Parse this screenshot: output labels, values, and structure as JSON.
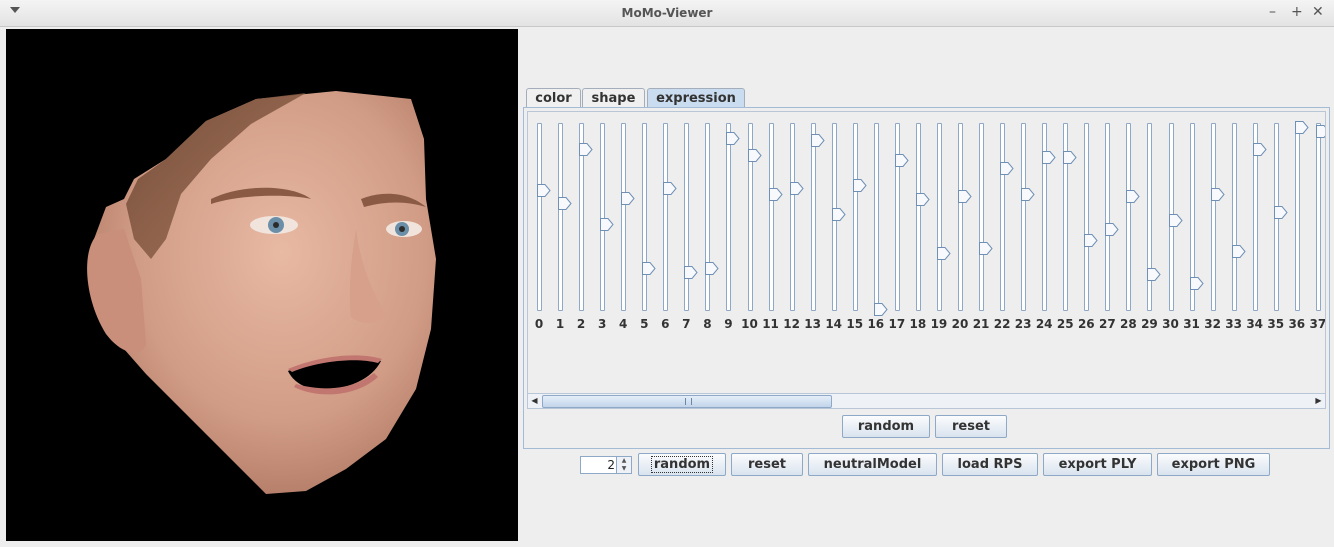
{
  "window": {
    "title": "MoMo-Viewer"
  },
  "tabs": [
    {
      "label": "color",
      "active": false
    },
    {
      "label": "shape",
      "active": false
    },
    {
      "label": "expression",
      "active": true
    }
  ],
  "sliders": [
    {
      "label": "0",
      "value": 0.65
    },
    {
      "label": "1",
      "value": 0.58
    },
    {
      "label": "2",
      "value": 0.87
    },
    {
      "label": "3",
      "value": 0.47
    },
    {
      "label": "4",
      "value": 0.61
    },
    {
      "label": "5",
      "value": 0.23
    },
    {
      "label": "6",
      "value": 0.66
    },
    {
      "label": "7",
      "value": 0.21
    },
    {
      "label": "8",
      "value": 0.23
    },
    {
      "label": "9",
      "value": 0.93
    },
    {
      "label": "10",
      "value": 0.84
    },
    {
      "label": "11",
      "value": 0.63
    },
    {
      "label": "12",
      "value": 0.66
    },
    {
      "label": "13",
      "value": 0.92
    },
    {
      "label": "14",
      "value": 0.52
    },
    {
      "label": "15",
      "value": 0.68
    },
    {
      "label": "16",
      "value": 0.01
    },
    {
      "label": "17",
      "value": 0.81
    },
    {
      "label": "18",
      "value": 0.6
    },
    {
      "label": "19",
      "value": 0.31
    },
    {
      "label": "20",
      "value": 0.62
    },
    {
      "label": "21",
      "value": 0.34
    },
    {
      "label": "22",
      "value": 0.77
    },
    {
      "label": "23",
      "value": 0.63
    },
    {
      "label": "24",
      "value": 0.83
    },
    {
      "label": "25",
      "value": 0.83
    },
    {
      "label": "26",
      "value": 0.38
    },
    {
      "label": "27",
      "value": 0.44
    },
    {
      "label": "28",
      "value": 0.62
    },
    {
      "label": "29",
      "value": 0.2
    },
    {
      "label": "30",
      "value": 0.49
    },
    {
      "label": "31",
      "value": 0.15
    },
    {
      "label": "32",
      "value": 0.63
    },
    {
      "label": "33",
      "value": 0.32
    },
    {
      "label": "34",
      "value": 0.87
    },
    {
      "label": "35",
      "value": 0.53
    },
    {
      "label": "36",
      "value": 0.99
    },
    {
      "label": "37",
      "value": 0.97
    }
  ],
  "panel_buttons": {
    "random": "random",
    "reset": "reset"
  },
  "bottom": {
    "spinner_value": "2",
    "random": "random",
    "reset": "reset",
    "neutral": "neutralModel",
    "load_rps": "load RPS",
    "export_ply": "export PLY",
    "export_png": "export PNG"
  },
  "scrollbar": {
    "position": 0.0,
    "visible_fraction": 0.37
  },
  "colors": {
    "accent": "#c9dcf0",
    "border": "#8ea9c8",
    "canvas_bg": "#000000"
  },
  "icons": {
    "menu": "chevron-down-icon",
    "minimize": "minimize-icon",
    "maximize": "maximize-icon",
    "close": "close-icon"
  }
}
